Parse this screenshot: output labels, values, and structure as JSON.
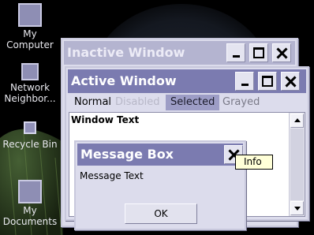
{
  "desktop": {
    "icons": [
      {
        "label": "My\nComputer",
        "name": "my-computer-icon"
      },
      {
        "label": "Network\nNeighbor...",
        "name": "network-neighborhood-icon"
      },
      {
        "label": "Recycle Bin",
        "name": "recycle-bin-icon"
      },
      {
        "label": "My\nDocuments",
        "name": "my-documents-icon"
      }
    ]
  },
  "inactive_window": {
    "title": "Inactive Window",
    "buttons": {
      "minimize": "minimize-icon",
      "maximize": "maximize-icon",
      "close": "close-icon"
    }
  },
  "active_window": {
    "title": "Active Window",
    "menu": {
      "normal": "Normal",
      "disabled": "Disabled",
      "selected": "Selected",
      "grayed": "Grayed"
    },
    "window_text": "Window Text"
  },
  "message_box": {
    "title": "Message Box",
    "text": "Message Text",
    "ok_label": "OK"
  },
  "tooltip": {
    "text": "Info"
  },
  "colors": {
    "active_title": "#7b7bb0",
    "inactive_title": "#b4b4d0",
    "selected_menu": "#9d9dc6",
    "face": "#dcdcec",
    "tooltip_bg": "#ffffd8"
  }
}
